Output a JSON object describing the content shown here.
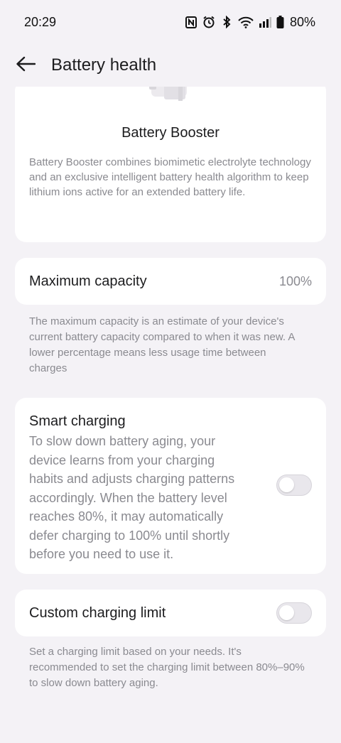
{
  "status_bar": {
    "time": "20:29",
    "icons": [
      "nfc-icon",
      "alarm-icon",
      "bluetooth-icon",
      "wifi-icon",
      "signal-icon",
      "battery-icon"
    ],
    "battery_percent": "80%"
  },
  "app_bar": {
    "title": "Battery health",
    "back_icon": "back-arrow-icon"
  },
  "booster": {
    "title": "Battery Booster",
    "description": "Battery Booster combines biomimetic electrolyte technology and an exclusive intelligent battery health algorithm to keep lithium ions active for an extended battery life."
  },
  "capacity": {
    "label": "Maximum capacity",
    "value": "100%",
    "caption": "The maximum capacity is an estimate of your device's current battery capacity compared to when it was new. A lower percentage means less usage time between charges"
  },
  "smart_charging": {
    "label": "Smart charging",
    "description": "To slow down battery aging, your device learns from your charging habits and adjusts charging patterns accordingly. When the battery level reaches 80%, it may automatically defer charging to 100% until shortly before you need to use it.",
    "enabled": false
  },
  "custom_limit": {
    "label": "Custom charging limit",
    "caption": "Set a charging limit based on your needs. It's recommended to set the charging limit between 80%–90% to slow down battery aging.",
    "enabled": false
  },
  "colors": {
    "background": "#f4f2f6",
    "card": "#ffffff",
    "primary_text": "#1c1c1e",
    "secondary_text": "#8a8a90",
    "toggle_off": "#e9e7ec"
  }
}
